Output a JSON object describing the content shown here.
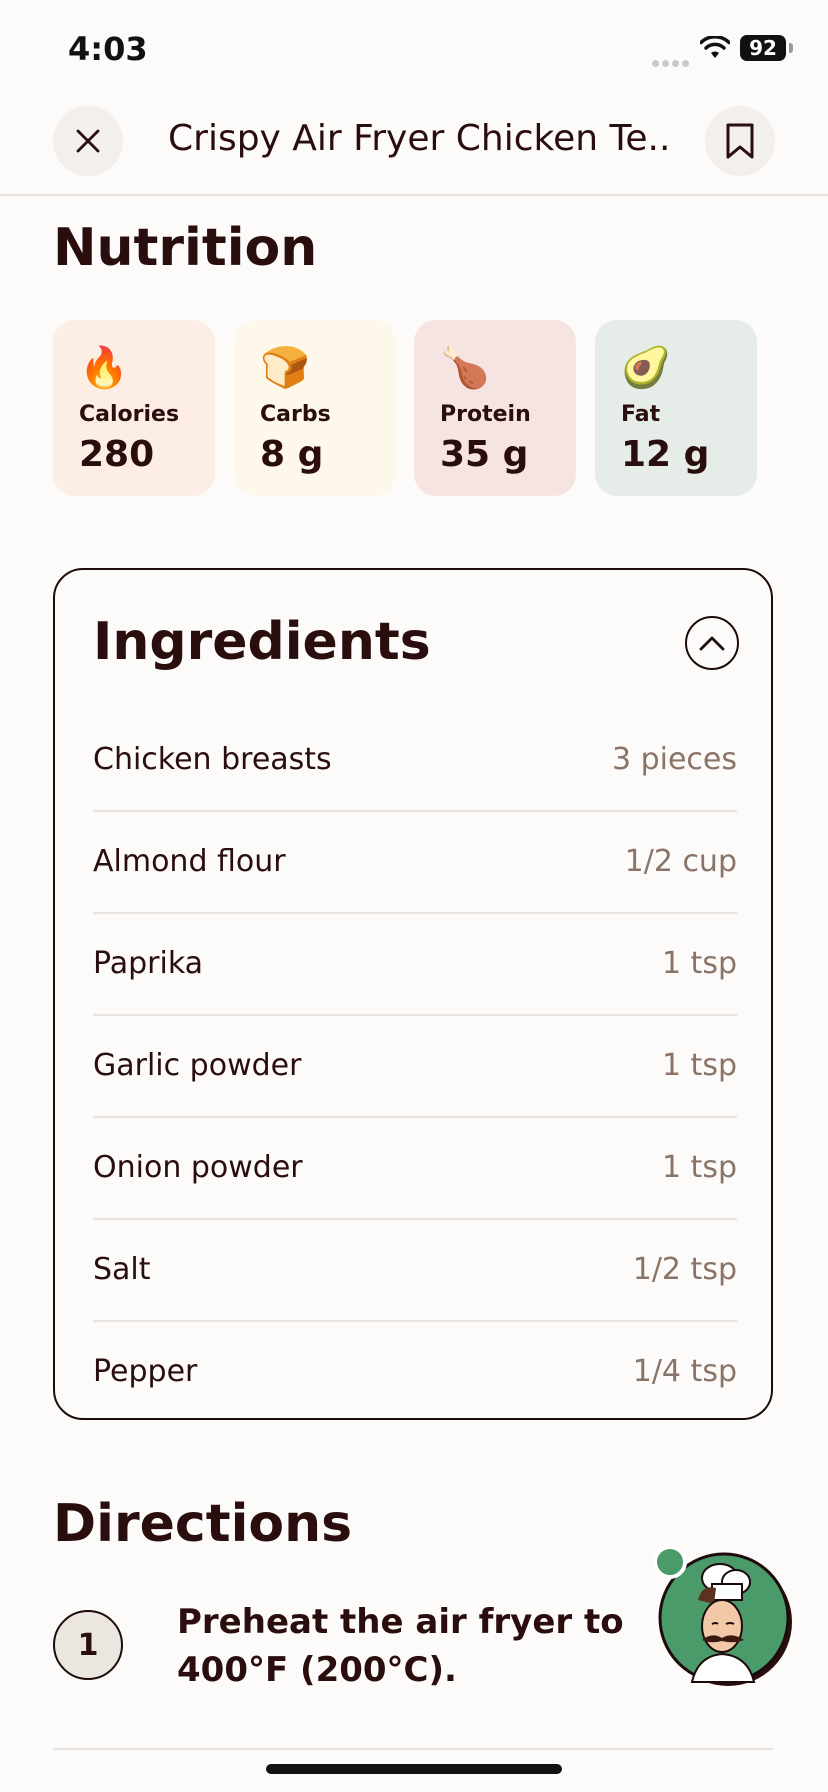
{
  "status_bar": {
    "time": "4:03",
    "battery": "92"
  },
  "header": {
    "title": "Crispy Air Fryer Chicken Te..."
  },
  "nutrition": {
    "title": "Nutrition",
    "items": [
      {
        "emoji": "🔥",
        "label": "Calories",
        "value": "280",
        "bg": "#fdeee5"
      },
      {
        "emoji": "🍞",
        "label": "Carbs",
        "value": "8 g",
        "bg": "#fdf8ea"
      },
      {
        "emoji": "🍗",
        "label": "Protein",
        "value": "35 g",
        "bg": "#f6e4e2"
      },
      {
        "emoji": "🥑",
        "label": "Fat",
        "value": "12 g",
        "bg": "#e6ece7"
      }
    ]
  },
  "ingredients": {
    "title": "Ingredients",
    "items": [
      {
        "name": "Chicken breasts",
        "qty": "3 pieces"
      },
      {
        "name": "Almond flour",
        "qty": "1/2 cup"
      },
      {
        "name": "Paprika",
        "qty": "1 tsp"
      },
      {
        "name": "Garlic powder",
        "qty": "1 tsp"
      },
      {
        "name": "Onion powder",
        "qty": "1 tsp"
      },
      {
        "name": "Salt",
        "qty": "1/2 tsp"
      },
      {
        "name": "Pepper",
        "qty": "1/4 tsp"
      }
    ]
  },
  "directions": {
    "title": "Directions",
    "steps": [
      {
        "number": "1",
        "text": "Preheat the air fryer to 400°F (200°C)."
      }
    ]
  },
  "colors": {
    "text": "#2a0e0e",
    "quantity": "#8a7468",
    "chef_bg": "#4a9a6a"
  }
}
